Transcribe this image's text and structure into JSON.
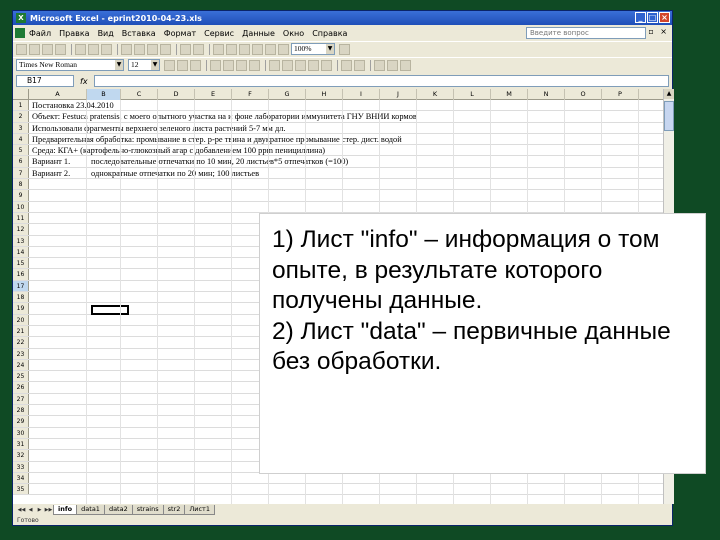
{
  "window": {
    "title": "Microsoft Excel - eprint2010-04-23.xls"
  },
  "menu": {
    "items": [
      "Файл",
      "Правка",
      "Вид",
      "Вставка",
      "Формат",
      "Сервис",
      "Данные",
      "Окно",
      "Справка"
    ],
    "help_placeholder": "Введите вопрос"
  },
  "toolbar": {
    "zoom": "100%",
    "font_name": "Times New Roman",
    "font_size": "12"
  },
  "formula_bar": {
    "name_box": "B17",
    "fx": "fx"
  },
  "grid": {
    "columns": [
      "A",
      "B",
      "C",
      "D",
      "E",
      "F",
      "G",
      "H",
      "I",
      "J",
      "K",
      "L",
      "M",
      "N",
      "O",
      "P"
    ],
    "active_column": "B",
    "active_row": 17,
    "row_count": 35,
    "cells": {
      "row1": "Постановка 23.04.2010",
      "row2": "Объект: Festuca pratensis, с моего опытного участка на и фоне лаборатории иммунитета ГНУ ВНИИ кормов",
      "row3": "Использовали фрагменты верхнего зеленого листа растений 5-7 мм дл.",
      "row4": "Предварительная обработка: промывание в стер. р-ре твина и двукратное промывание стер. дист. водой",
      "row5": "Среда: КГА+ (картофельно-глюкозный агар с добавлением 100 ppm пенициллина)",
      "row6_a": "Вариант 1.",
      "row6_b": "последовательные отпечатки по 10 мин, 20 листьев*5 отпечатков (=100)",
      "row7_a": "Вариант 2.",
      "row7_b": "однократные отпечатки по 20 мин; 100 листьев"
    }
  },
  "sheet_tabs": {
    "tabs": [
      "info",
      "data1",
      "data2",
      "strains",
      "str2",
      "Лист1"
    ],
    "active": "info"
  },
  "status_bar": {
    "text": "Готово"
  },
  "callout": {
    "text": "1) Лист \"info\" – информация о том опыте, в результате которого получены данные.\n2) Лист \"data\" – первичные данные без обработки."
  },
  "colors": {
    "background": "#0f4a24",
    "titlebar": "#2a5fd0",
    "selection": "#c0d8ef"
  }
}
